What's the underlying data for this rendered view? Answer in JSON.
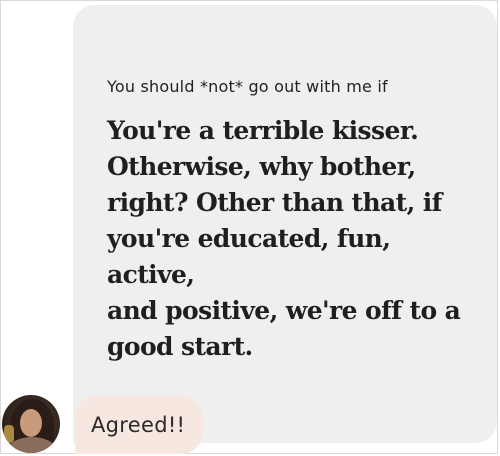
{
  "prompt": {
    "question": "You should *not* go out with me if",
    "answer": "You're a terrible kisser.\nOtherwise, why bother,\nright? Other than that, if\nyou're educated, fun, active,\nand positive, we're off to a\ngood start."
  },
  "reply": {
    "text": "Agreed!!"
  },
  "colors": {
    "card_background": "#efeff0",
    "reply_background": "#f6e7e0",
    "text_dark": "#1f1f1f"
  },
  "icons": {
    "avatar": "user-photo-avatar"
  }
}
